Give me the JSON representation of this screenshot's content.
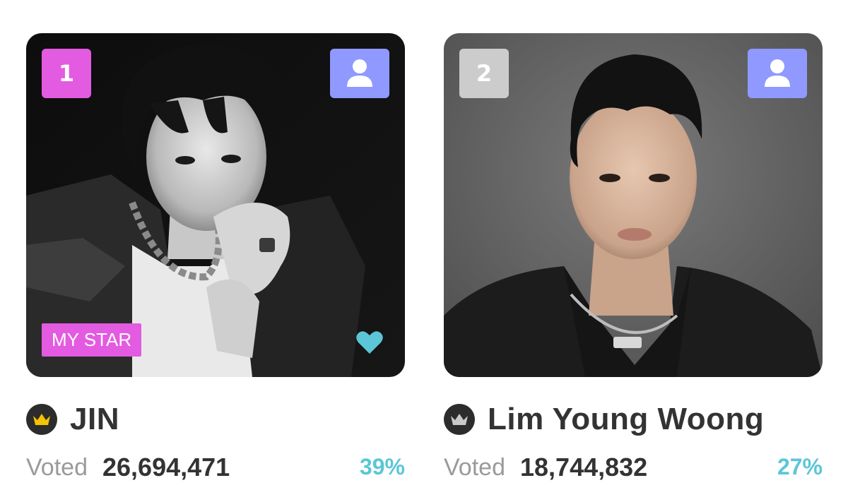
{
  "rankings": [
    {
      "rank": "1",
      "rank_color": "#e35be0",
      "name": "JIN",
      "voted_label": "Voted",
      "votes": "26,694,471",
      "percent": "39%",
      "badge": "MY STAR",
      "crown_color": "#f5c400",
      "favorite": true,
      "photo": "black-and-white portrait"
    },
    {
      "rank": "2",
      "rank_color": "#cccccc",
      "name": "Lim Young Woong",
      "voted_label": "Voted",
      "votes": "18,744,832",
      "percent": "27%",
      "crown_color": "#c9c9c9",
      "favorite": false,
      "photo": "color portrait"
    }
  ],
  "colors": {
    "profile_button": "#8f99ff",
    "percent": "#5cc6d8",
    "heart": "#5cc6d8",
    "my_star_badge": "#e35be0"
  },
  "icons": {
    "profile": "user-icon",
    "crown": "crown-icon",
    "heart": "heart-icon"
  }
}
